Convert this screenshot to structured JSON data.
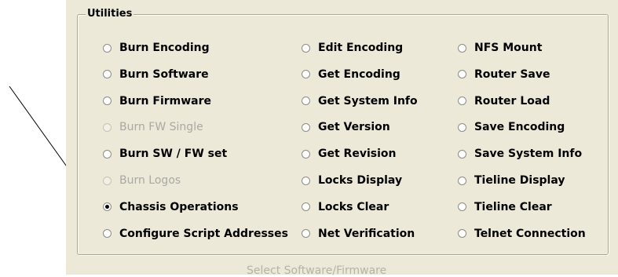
{
  "groupbox": {
    "title": "Utilities"
  },
  "options": {
    "col1": [
      {
        "label": "Burn Encoding",
        "state": "unchecked"
      },
      {
        "label": "Burn Software",
        "state": "unchecked"
      },
      {
        "label": "Burn Firmware",
        "state": "unchecked"
      },
      {
        "label": "Burn FW Single",
        "state": "disabled"
      },
      {
        "label": "Burn SW / FW set",
        "state": "unchecked"
      },
      {
        "label": "Burn Logos",
        "state": "disabled"
      },
      {
        "label": "Chassis Operations",
        "state": "checked"
      },
      {
        "label": "Configure Script Addresses",
        "state": "unchecked"
      }
    ],
    "col2": [
      {
        "label": "Edit Encoding",
        "state": "unchecked"
      },
      {
        "label": "Get Encoding",
        "state": "unchecked"
      },
      {
        "label": "Get System Info",
        "state": "unchecked"
      },
      {
        "label": "Get Version",
        "state": "unchecked"
      },
      {
        "label": "Get Revision",
        "state": "unchecked"
      },
      {
        "label": "Locks Display",
        "state": "unchecked"
      },
      {
        "label": "Locks Clear",
        "state": "unchecked"
      },
      {
        "label": "Net Verification",
        "state": "unchecked"
      }
    ],
    "col3": [
      {
        "label": "NFS Mount",
        "state": "unchecked"
      },
      {
        "label": "Router Save",
        "state": "unchecked"
      },
      {
        "label": "Router Load",
        "state": "unchecked"
      },
      {
        "label": "Save Encoding",
        "state": "unchecked"
      },
      {
        "label": "Save System Info",
        "state": "unchecked"
      },
      {
        "label": "Tieline Display",
        "state": "unchecked"
      },
      {
        "label": "Tieline Clear",
        "state": "unchecked"
      },
      {
        "label": "Telnet Connection",
        "state": "unchecked"
      }
    ]
  },
  "footer": {
    "label": "Select Software/Firmware"
  },
  "annotation": {
    "icon": "arrow-pointer-icon",
    "color": "#000000"
  }
}
